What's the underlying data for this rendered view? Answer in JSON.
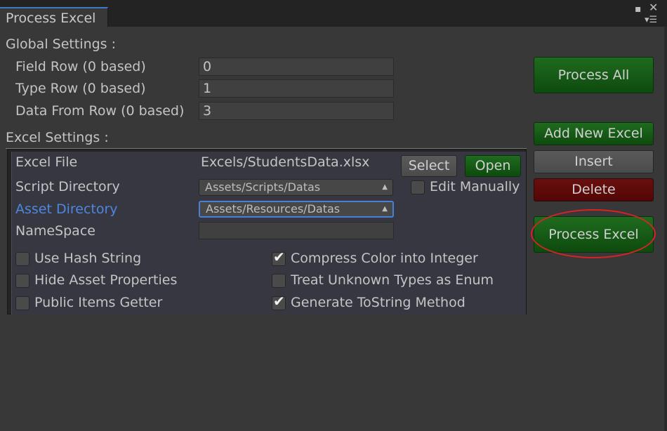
{
  "window": {
    "tab_title": "Process Excel",
    "icons": [
      "maximize-icon",
      "close-icon",
      "menu-icon"
    ]
  },
  "global": {
    "title": "Global Settings :",
    "field_row": {
      "label": "Field Row (0 based)",
      "value": "0"
    },
    "type_row": {
      "label": "Type Row (0 based)",
      "value": "1"
    },
    "data_row": {
      "label": "Data From Row (0 based)",
      "value": "3"
    }
  },
  "excel_settings": {
    "title": "Excel Settings :",
    "excel_file": {
      "label": "Excel File",
      "value": "Excels/StudentsData.xlsx"
    },
    "select_label": "Select",
    "open_label": "Open",
    "script_dir": {
      "label": "Script Directory",
      "value": "Assets/Scripts/Datas"
    },
    "edit_manually": {
      "label": "Edit Manually",
      "checked": false
    },
    "asset_dir": {
      "label": "Asset Directory",
      "value": "Assets/Resources/Datas"
    },
    "namespace": {
      "label": "NameSpace",
      "value": ""
    },
    "options": {
      "use_hash_string": {
        "label": "Use Hash String",
        "checked": false
      },
      "hide_asset_properties": {
        "label": "Hide Asset Properties",
        "checked": false
      },
      "public_items_getter": {
        "label": "Public Items Getter",
        "checked": false
      },
      "compress_color": {
        "label": "Compress Color into Integer",
        "checked": true
      },
      "treat_unknown": {
        "label": "Treat Unknown Types as Enum",
        "checked": false
      },
      "generate_tostring": {
        "label": "Generate ToString Method",
        "checked": true
      }
    }
  },
  "side_buttons": {
    "process_all": "Process All",
    "add_new_excel": "Add New Excel",
    "insert": "Insert",
    "delete": "Delete",
    "process_excel": "Process Excel"
  },
  "colors": {
    "background": "#383838",
    "green_button": "#1a661a",
    "red_button": "#650c0c",
    "accent_blue": "#4f86df",
    "highlight_ring": "#d62424"
  }
}
